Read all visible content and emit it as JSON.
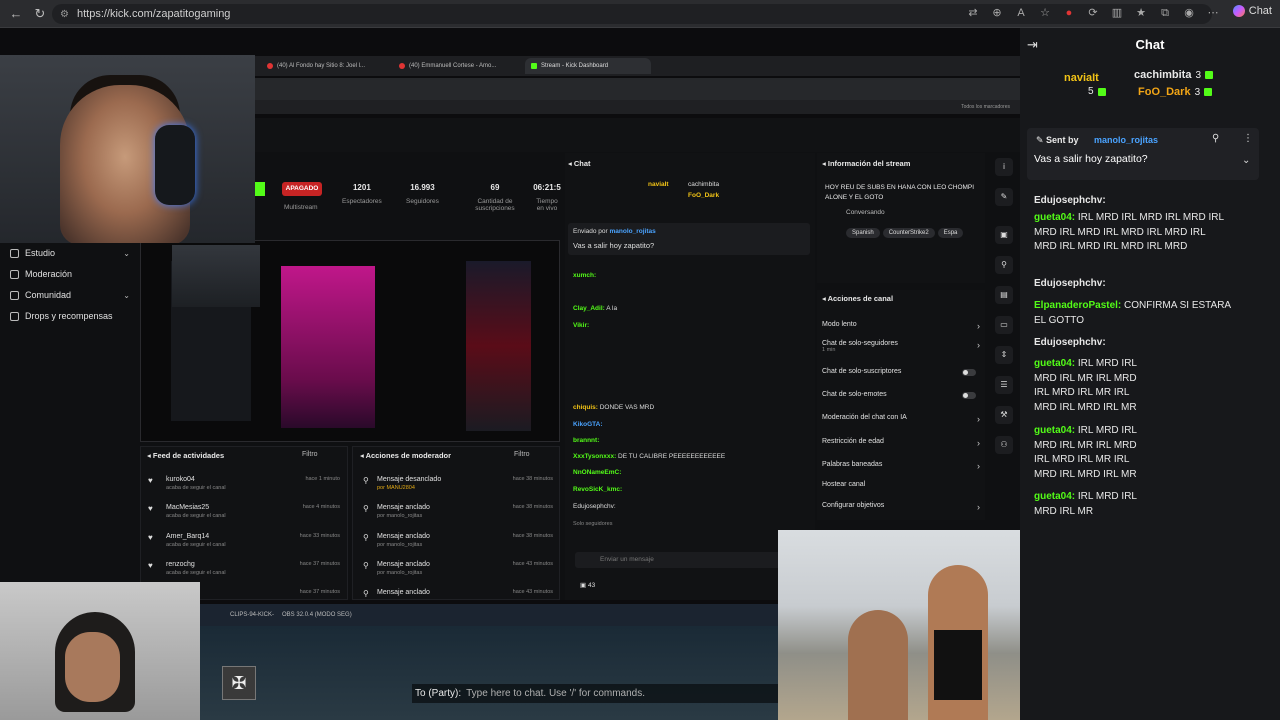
{
  "browser": {
    "url": "https://kick.com/zapatitogaming",
    "chat_button": "Chat"
  },
  "inner_browser": {
    "tabs": [
      "(40) Al Fondo hay Sitio 8: Joel l...",
      "(40) Emmanuell Cortese - Amo...",
      "Stream - Kick Dashboard"
    ],
    "bookmarks_label": "Todos los marcadores"
  },
  "dashboard": {
    "nav": [
      "Estudio",
      "Moderación",
      "Comunidad",
      "Drops y recompensas"
    ],
    "status_badge": "APAGADO",
    "stats": [
      {
        "value": "",
        "label": "Multistream"
      },
      {
        "value": "1201",
        "label": "Espectadores"
      },
      {
        "value": "16.993",
        "label": "Seguidores"
      },
      {
        "value": "69",
        "label": "Cantidad de suscripciones"
      },
      {
        "value": "06:21:5",
        "label": "Tiempo en vivo"
      }
    ],
    "feed": {
      "title": "Feed de actividades",
      "filter": "Filtro",
      "rows": [
        {
          "user": "kuroko04",
          "sub": "acaba de seguir el canal",
          "time": "hace 1 minuto"
        },
        {
          "user": "MacMesias25",
          "sub": "acaba de seguir el canal",
          "time": "hace 4 minutos"
        },
        {
          "user": "Amer_Barq14",
          "sub": "acaba de seguir el canal",
          "time": "hace 33 minutos"
        },
        {
          "user": "renzochg",
          "sub": "acaba de seguir el canal",
          "time": "hace 37 minutos"
        },
        {
          "user": "",
          "sub": "",
          "time": "hace 37 minutos"
        }
      ]
    },
    "mod": {
      "title": "Acciones de moderador",
      "filter": "Filtro",
      "rows": [
        {
          "action": "Mensaje desanclado",
          "by": "por MANU2804",
          "time": "hace 38 minutos"
        },
        {
          "action": "Mensaje anclado",
          "by": "por manolo_rojitas",
          "time": "hace 38 minutos"
        },
        {
          "action": "Mensaje anclado",
          "by": "por manolo_rojitas",
          "time": "hace 38 minutos"
        },
        {
          "action": "Mensaje anclado",
          "by": "por manolo_rojitas",
          "time": "hace 43 minutos"
        },
        {
          "action": "Mensaje anclado",
          "by": "",
          "time": "hace 43 minutos"
        }
      ]
    },
    "chat": {
      "title": "Chat",
      "leaders": [
        "naviaIt",
        "cachimbita",
        "FoO_Dark"
      ],
      "pinned_by": "Enviado por",
      "pinned_user": "manolo_rojitas",
      "pinned_msg": "Vas a salir hoy zapatito?",
      "lines": [
        {
          "user": "xumch:",
          "msg": ""
        },
        {
          "user": "Clay_Adil:",
          "msg": "A la"
        },
        {
          "user": "Vikir:",
          "msg": ""
        },
        {
          "user": "chiquis:",
          "msg": "DONDE VAS MRD"
        },
        {
          "user": "KikoGTA:",
          "msg": ""
        },
        {
          "user": "brannnt:",
          "msg": ""
        },
        {
          "user": "XxxTysonxxx:",
          "msg": "DE TU CALIBRE PEEEEEEEEEEEE"
        },
        {
          "user": "NnONameEmC:",
          "msg": ""
        },
        {
          "user": "RevoSicK_kmc:",
          "msg": ""
        },
        {
          "user": "Edujosephchv:",
          "msg": ""
        }
      ],
      "followers_only": "Solo seguidores",
      "input_placeholder": "Enviar un mensaje",
      "count": "43"
    },
    "info": {
      "title": "Información del stream",
      "stream_title": "HOY REU DE SUBS EN HANA CON LEO CHOMPI ALONE Y EL GOTO",
      "category": "Conversando",
      "tags": [
        "Spanish",
        "CounterStrike2",
        "Espa"
      ]
    },
    "actions": {
      "title": "Acciones de canal",
      "rows": [
        {
          "label": "Modo lento",
          "sub": "",
          "kind": "chev"
        },
        {
          "label": "Chat de solo-seguidores",
          "sub": "1 min",
          "kind": "chev"
        },
        {
          "label": "Chat de solo-suscriptores",
          "sub": "",
          "kind": "toggle"
        },
        {
          "label": "Chat de solo-emotes",
          "sub": "",
          "kind": "toggle"
        },
        {
          "label": "Moderación del chat con IA",
          "sub": "",
          "kind": "chev"
        },
        {
          "label": "Restricción de edad",
          "sub": "",
          "kind": "chev"
        },
        {
          "label": "Palabras baneadas",
          "sub": "",
          "kind": "chev"
        },
        {
          "label": "Hostear canal",
          "sub": "",
          "kind": "none"
        },
        {
          "label": "Configurar objetivos",
          "sub": "",
          "kind": "chev"
        }
      ]
    }
  },
  "obs_bar": {
    "items": [
      "CLIPS-94-KICK-",
      "OBS 32.0.4 (MODO SEG)"
    ]
  },
  "game": {
    "party_label": "To (Party):",
    "party_placeholder": "Type here to chat. Use '/' for commands."
  },
  "right_chat": {
    "title": "Chat",
    "leaders": [
      {
        "name": "naviaIt",
        "count": "5",
        "color": "#f2c316"
      },
      {
        "name": "cachimbita",
        "count": "3",
        "color": "#e8e8e8"
      },
      {
        "name": "FoO_Dark",
        "count": "3",
        "color": "#f2a516"
      }
    ],
    "pinned_sent_by": "Sent by",
    "pinned_user": "manolo_rojitas",
    "pinned_msg": "Vas a salir hoy zapatito?",
    "messages": [
      {
        "user": "Edujosephchv:",
        "color": "#e8e8e8",
        "text": ""
      },
      {
        "user": "gueta04:",
        "color": "#53fc18",
        "text": "IRL MRD  IRL MRD  IRL MRD  IRL MRD  IRL MRD  IRL MRD  IRL MRD  IRL MRD  IRL MRD  IRL MRD  IRL MRD"
      },
      {
        "user": "Edujosephchv:",
        "color": "#e8e8e8",
        "text": ""
      },
      {
        "user": "ElpanaderoPastel:",
        "color": "#53fc18",
        "text": "CONFIRMA SI ESTARA EL GOTTO"
      },
      {
        "user": "Edujosephchv:",
        "color": "#e8e8e8",
        "text": ""
      },
      {
        "user": "gueta04:",
        "color": "#53fc18",
        "text": "IRL MRD  IRL MRD  IRL MR  IRL MRD  IRL MRD  IRL MR  IRL MRD  IRL MRD  IRL MR"
      },
      {
        "user": "gueta04:",
        "color": "#53fc18",
        "text": "IRL MRD  IRL MRD  IRL MR  IRL MRD  IRL MRD  IRL MR  IRL MRD  IRL MRD  IRL MR"
      },
      {
        "user": "gueta04:",
        "color": "#53fc18",
        "text": "IRL MRD  IRL MRD  IRL MR"
      }
    ]
  }
}
